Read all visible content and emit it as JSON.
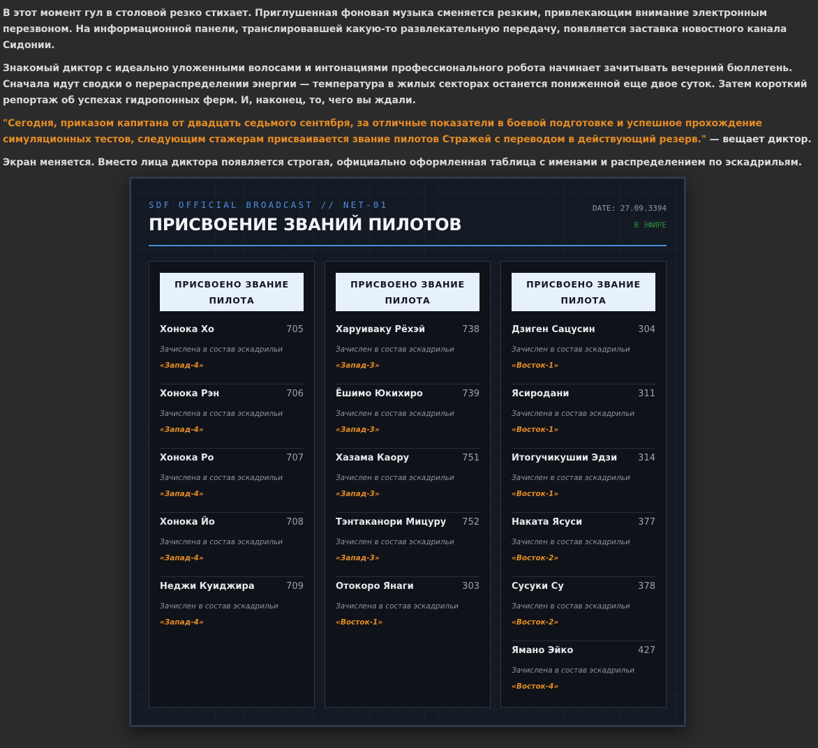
{
  "story": {
    "p1": "В этот момент гул в столовой резко стихает. Приглушенная фоновая музыка сменяется резким, привлекающим внимание электронным перезвоном. На информационной панели, транслировавшей какую-то развлекательную передачу, появляется заставка новостного канала Сидонии.",
    "p2": "Знакомый диктор с идеально уложенными волосами и интонациями профессионального робота начинает зачитывать вечерний бюллетень. Сначала идут сводки о перераспределении энергии — температура в жилых секторах останется пониженной еще двое суток. Затем короткий репортаж об успехах гидропонных ферм. И, наконец, то, чего вы ждали.",
    "p3_quote": "\"Сегодня, приказом капитана от двадцать седьмого сентября, за отличные показатели в боевой подготовке и успешное прохождение симуляционных тестов, следующим стажерам присваивается звание пилотов Стражей с переводом в действующий резерв.\"",
    "p3_tail": " — вещает диктор.",
    "p4": "Экран меняется. Вместо лица диктора появляется строгая, официально оформленная таблица с именами и распределением по эскадрильям."
  },
  "broadcast": {
    "kicker": "SDF OFFICIAL BROADCAST // NET-01",
    "title": "ПРИСВОЕНИЕ ЗВАНИЙ ПИЛОТОВ",
    "date": "DATE: 27.09.3394",
    "live": "В ЭФИРЕ",
    "columns": [
      {
        "badge": "ПРИСВОЕНО ЗВАНИЕ ПИЛОТА",
        "entries": [
          {
            "name": "Хонока Хо",
            "number": "705",
            "status": "Зачислена в состав эскадрильи",
            "squadron": "«Запад-4»"
          },
          {
            "name": "Хонока Рэн",
            "number": "706",
            "status": "Зачислена в состав эскадрильи",
            "squadron": "«Запад-4»"
          },
          {
            "name": "Хонока Ро",
            "number": "707",
            "status": "Зачислена в состав эскадрильи",
            "squadron": "«Запад-4»"
          },
          {
            "name": "Хонока Йо",
            "number": "708",
            "status": "Зачислена в состав эскадрильи",
            "squadron": "«Запад-4»"
          },
          {
            "name": "Неджи Куиджира",
            "number": "709",
            "status": "Зачислен в состав эскадрильи",
            "squadron": "«Запад-4»"
          }
        ]
      },
      {
        "badge": "ПРИСВОЕНО ЗВАНИЕ ПИЛОТА",
        "entries": [
          {
            "name": "Харуиваку Рёхэй",
            "number": "738",
            "status": "Зачислен в состав эскадрильи",
            "squadron": "«Запад-3»"
          },
          {
            "name": "Ёшимо Юкихиро",
            "number": "739",
            "status": "Зачислен в состав эскадрильи",
            "squadron": "«Запад-3»"
          },
          {
            "name": "Хазама Каору",
            "number": "751",
            "status": "Зачислен в состав эскадрильи",
            "squadron": "«Запад-3»"
          },
          {
            "name": "Тэнтаканори Мицуру",
            "number": "752",
            "status": "Зачислен в состав эскадрильи",
            "squadron": "«Запад-3»"
          },
          {
            "name": "Отокоро Янаги",
            "number": "303",
            "status": "Зачислена в состав эскадрильи",
            "squadron": "«Восток-1»"
          }
        ]
      },
      {
        "badge": "ПРИСВОЕНО ЗВАНИЕ ПИЛОТА",
        "entries": [
          {
            "name": "Дзиген Сацусин",
            "number": "304",
            "status": "Зачислен в состав эскадрильи",
            "squadron": "«Восток-1»"
          },
          {
            "name": "Ясиродани",
            "number": "311",
            "status": "Зачислена в состав эскадрильи",
            "squadron": "«Восток-1»"
          },
          {
            "name": "Итогучикушии Эдзи",
            "number": "314",
            "status": "Зачислен в состав эскадрильи",
            "squadron": "«Восток-1»"
          },
          {
            "name": "Наката Ясуси",
            "number": "377",
            "status": "Зачислен в состав эскадрильи",
            "squadron": "«Восток-2»"
          },
          {
            "name": "Сусуки Су",
            "number": "378",
            "status": "Зачислен в состав эскадрильи",
            "squadron": "«Восток-2»"
          },
          {
            "name": "Ямано Эйко",
            "number": "427",
            "status": "Зачислена в состав эскадрильи",
            "squadron": "«Восток-4»"
          }
        ]
      }
    ]
  }
}
